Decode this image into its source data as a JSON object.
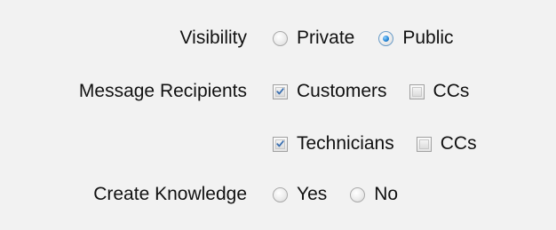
{
  "rows": [
    {
      "label": "Visibility",
      "options": [
        {
          "type": "radio",
          "label": "Private",
          "checked": false
        },
        {
          "type": "radio",
          "label": "Public",
          "checked": true
        }
      ]
    },
    {
      "label": "Message Recipients",
      "options": [
        {
          "type": "checkbox",
          "label": "Customers",
          "checked": true
        },
        {
          "type": "checkbox",
          "label": "CCs",
          "checked": false
        }
      ]
    },
    {
      "label": "",
      "options": [
        {
          "type": "checkbox",
          "label": "Technicians",
          "checked": true
        },
        {
          "type": "checkbox",
          "label": "CCs",
          "checked": false
        }
      ]
    },
    {
      "label": "Create Knowledge",
      "options": [
        {
          "type": "radio",
          "label": "Yes",
          "checked": false
        },
        {
          "type": "radio",
          "label": "No",
          "checked": false
        }
      ]
    }
  ],
  "colors": {
    "background": "#f2f2f2",
    "radio_selected": "#2a8ad8",
    "checkmark": "#3a6fb0"
  }
}
